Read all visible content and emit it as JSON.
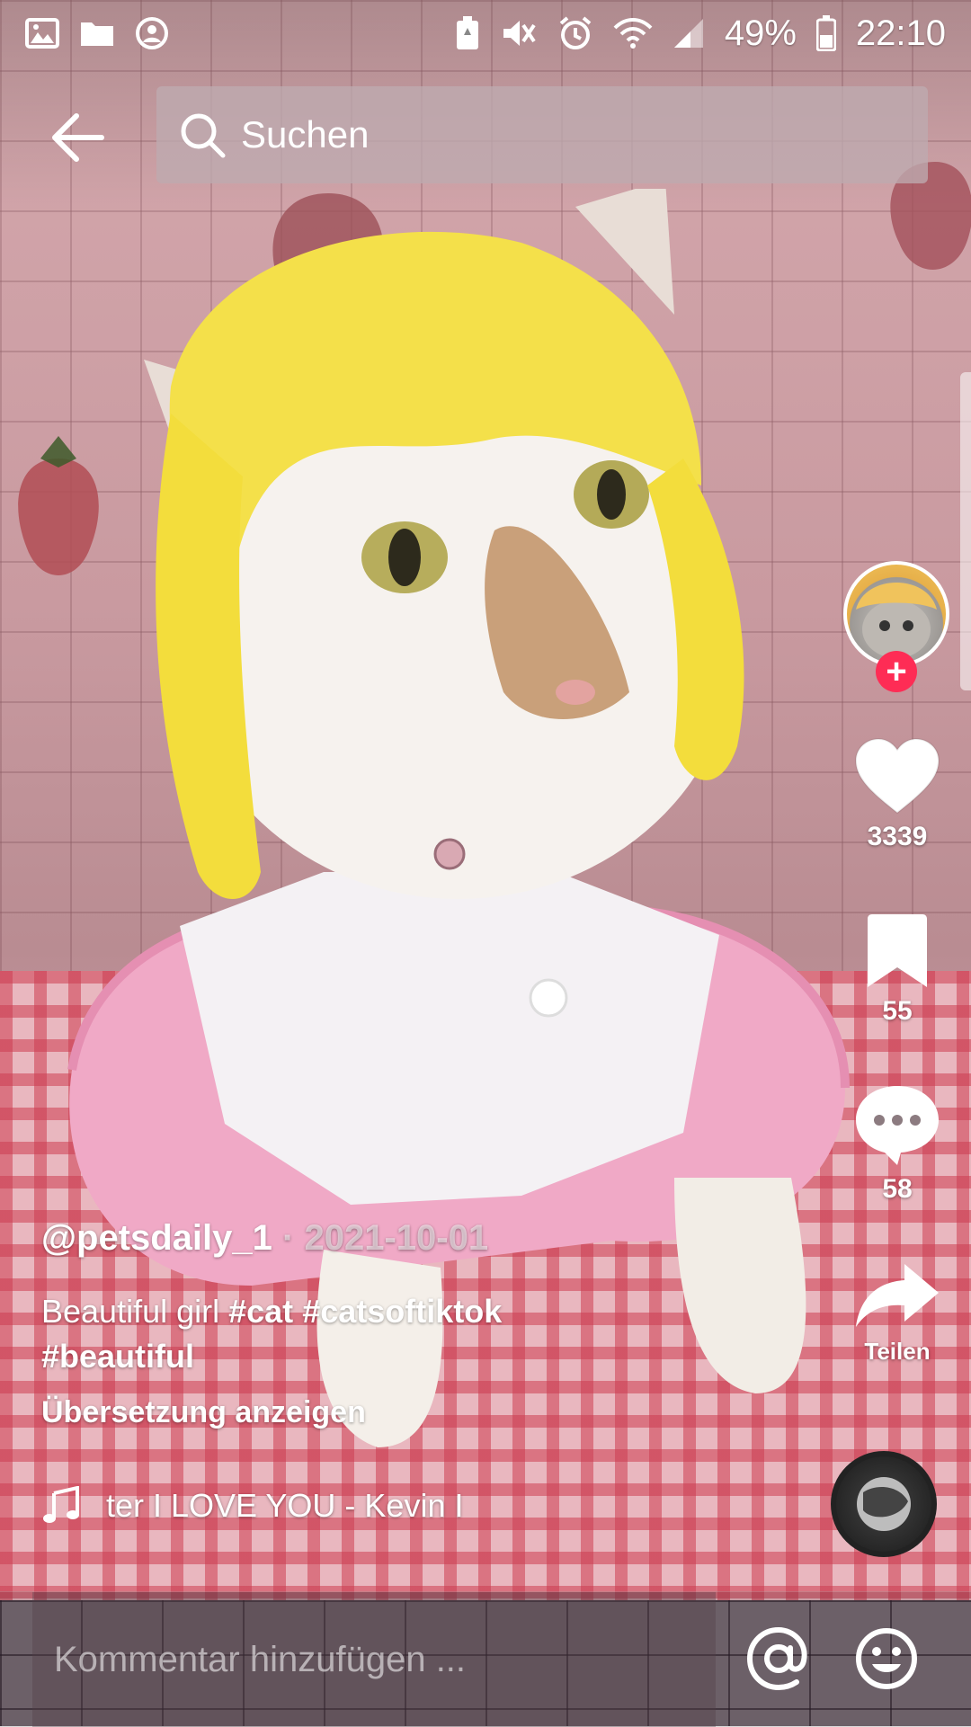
{
  "status_bar": {
    "battery": "49%",
    "time": "22:10"
  },
  "search": {
    "placeholder": "Suchen"
  },
  "actions": {
    "likes": "3339",
    "bookmarks": "55",
    "comments": "58",
    "share_label": "Teilen"
  },
  "post": {
    "username": "@petsdaily_1",
    "separator": " · ",
    "date": "2021-10-01",
    "description_text": "Beautiful girl ",
    "hashtags": [
      "#cat",
      "#catsoftiktok",
      "#beautiful"
    ],
    "translate_label": "Übersetzung anzeigen",
    "music": "ter    I LOVE YOU - Kevin I"
  },
  "comment": {
    "placeholder": "Kommentar hinzufügen ..."
  },
  "colors": {
    "follow_accent": "#fe2c55"
  },
  "icons": {
    "back": "arrow-left-icon",
    "search": "search-icon",
    "like": "heart-icon",
    "bookmark": "bookmark-icon",
    "comment": "speech-bubble-icon",
    "share": "share-arrow-icon",
    "music": "music-note-icon",
    "mention": "at-sign-icon",
    "emoji": "smiley-icon"
  }
}
